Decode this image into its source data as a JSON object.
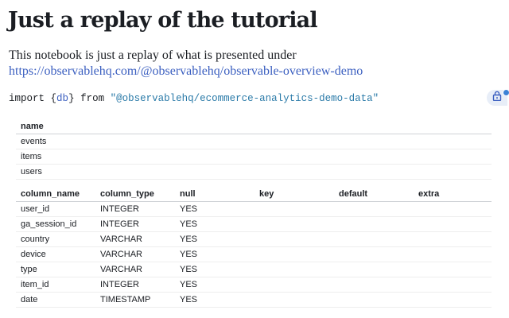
{
  "title": "Just a replay of the tutorial",
  "intro": "This notebook is just a replay of what is presented under",
  "link": "https://observablehq.com/@observablehq/observable-overview-demo",
  "code": {
    "kw_import": "import",
    "brace_open": "{",
    "var": "db",
    "brace_close": "}",
    "kw_from": "from",
    "source": "\"@observablehq/ecommerce-analytics-demo-data\""
  },
  "lock_icon": "lock-icon",
  "tables_table": {
    "header": "name",
    "rows": [
      "events",
      "items",
      "users"
    ]
  },
  "columns_table": {
    "headers": [
      "column_name",
      "column_type",
      "null",
      "key",
      "default",
      "extra"
    ],
    "rows": [
      [
        "user_id",
        "INTEGER",
        "YES"
      ],
      [
        "ga_session_id",
        "INTEGER",
        "YES"
      ],
      [
        "country",
        "VARCHAR",
        "YES"
      ],
      [
        "device",
        "VARCHAR",
        "YES"
      ],
      [
        "type",
        "VARCHAR",
        "YES"
      ],
      [
        "item_id",
        "INTEGER",
        "YES"
      ],
      [
        "date",
        "TIMESTAMP",
        "YES"
      ]
    ]
  }
}
